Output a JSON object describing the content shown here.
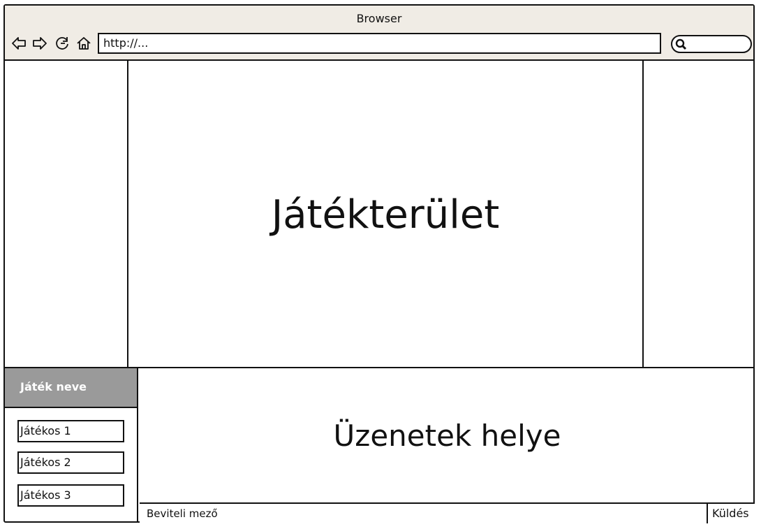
{
  "window": {
    "title": "Browser"
  },
  "toolbar": {
    "url": "http://...",
    "icons": [
      "back-arrow-icon",
      "forward-arrow-icon",
      "reload-icon",
      "home-icon",
      "search-icon"
    ]
  },
  "main": {
    "game_area_label": "Játékterület"
  },
  "sidebar": {
    "game_name": "Játék neve",
    "players": [
      "Játékos 1",
      "Játékos 2",
      "Játékos 3"
    ]
  },
  "chat": {
    "messages_label": "Üzenetek helye",
    "input_label": "Beviteli mező",
    "send_label": "Küldés"
  }
}
